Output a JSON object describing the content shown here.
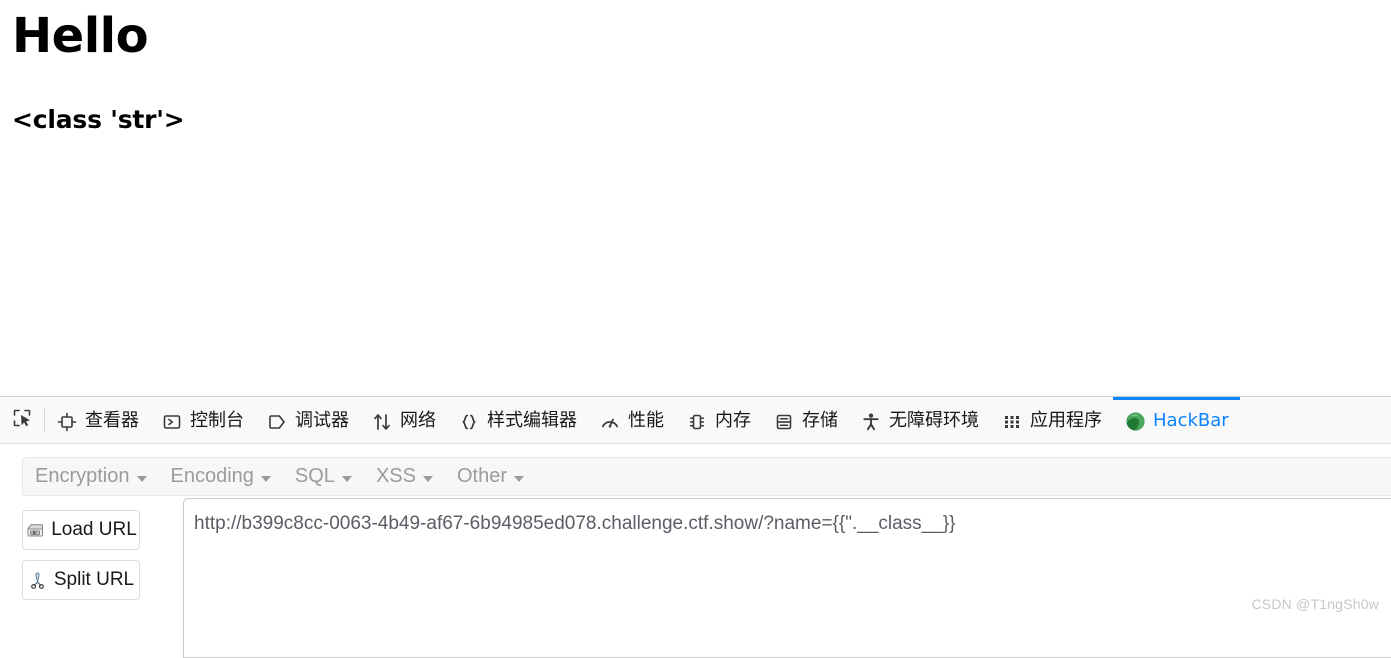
{
  "page": {
    "heading": "Hello",
    "subheading": "<class 'str'>"
  },
  "devtools": {
    "picker_icon": "element-picker-icon",
    "tabs": [
      {
        "label": "查看器",
        "icon": "inspector-icon",
        "active": false
      },
      {
        "label": "控制台",
        "icon": "console-icon",
        "active": false
      },
      {
        "label": "调试器",
        "icon": "debugger-icon",
        "active": false
      },
      {
        "label": "网络",
        "icon": "network-icon",
        "active": false
      },
      {
        "label": "样式编辑器",
        "icon": "style-editor-icon",
        "active": false
      },
      {
        "label": "性能",
        "icon": "performance-icon",
        "active": false
      },
      {
        "label": "内存",
        "icon": "memory-icon",
        "active": false
      },
      {
        "label": "存储",
        "icon": "storage-icon",
        "active": false
      },
      {
        "label": "无障碍环境",
        "icon": "accessibility-icon",
        "active": false
      },
      {
        "label": "应用程序",
        "icon": "application-icon",
        "active": false
      },
      {
        "label": "HackBar",
        "icon": "hackbar-icon",
        "active": true
      }
    ],
    "active_tab_color": "#0a84ff"
  },
  "hackbar": {
    "menus": [
      {
        "label": "Encryption"
      },
      {
        "label": "Encoding"
      },
      {
        "label": "SQL"
      },
      {
        "label": "XSS"
      },
      {
        "label": "Other"
      }
    ],
    "buttons": [
      {
        "label": "Load URL",
        "icon": "drive-load-icon"
      },
      {
        "label": "Split URL",
        "icon": "scissors-icon"
      }
    ],
    "url_field": {
      "value": "http://b399c8cc-0063-4b49-af67-6b94985ed078.challenge.ctf.show/?name={{\".__class__}}",
      "placeholder": ""
    }
  },
  "watermark": {
    "text": "CSDN @T1ngSh0w"
  }
}
